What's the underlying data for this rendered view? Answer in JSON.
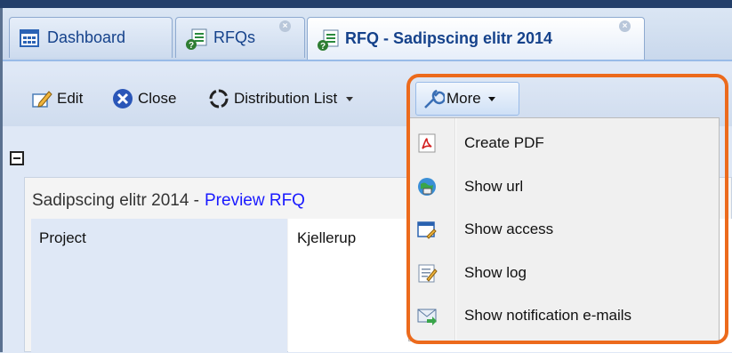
{
  "tabs": [
    {
      "label": "Dashboard",
      "icon": "dashboard-icon"
    },
    {
      "label": "RFQs",
      "icon": "rfq-doc-icon"
    },
    {
      "label": "RFQ - Sadipscing elitr 2014",
      "icon": "rfq-doc-icon",
      "active": true
    }
  ],
  "toolbar": {
    "edit_label": "Edit",
    "close_label": "Close",
    "distribution_label": "Distribution List",
    "more_label": "More"
  },
  "menu": {
    "items": [
      {
        "label": "Create PDF",
        "icon": "pdf-icon"
      },
      {
        "label": "Show url",
        "icon": "globe-icon"
      },
      {
        "label": "Show access",
        "icon": "access-key-icon"
      },
      {
        "label": "Show log",
        "icon": "log-icon"
      },
      {
        "label": "Show notification e-mails",
        "icon": "mail-icon"
      }
    ]
  },
  "content": {
    "title": "Sadipscing elitr 2014 -",
    "preview_link": "Preview RFQ",
    "rows": [
      {
        "label": "Project",
        "value": "Kjellerup"
      }
    ]
  },
  "colors": {
    "highlight": "#ec6a1c",
    "tab_text": "#15428b",
    "link": "#1a1aff"
  }
}
